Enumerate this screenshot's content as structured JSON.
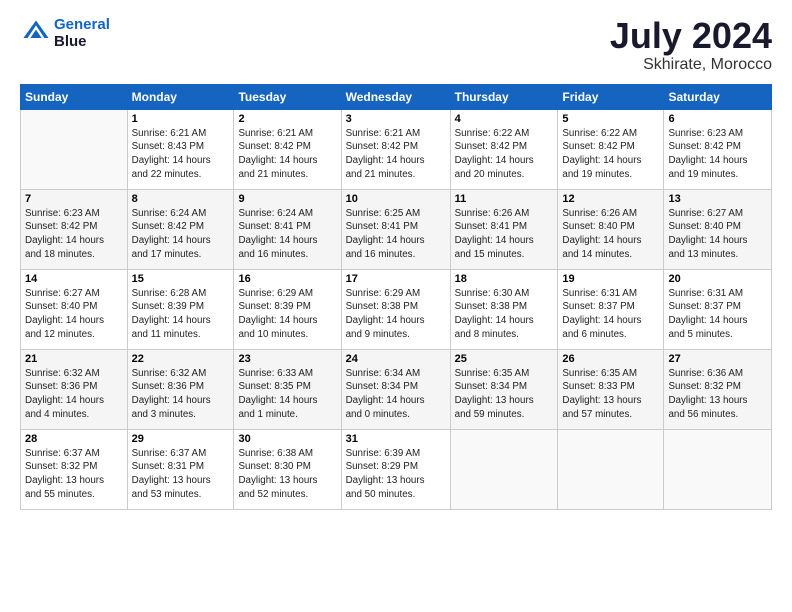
{
  "logo": {
    "line1": "General",
    "line2": "Blue"
  },
  "title": "July 2024",
  "subtitle": "Skhirate, Morocco",
  "days_of_week": [
    "Sunday",
    "Monday",
    "Tuesday",
    "Wednesday",
    "Thursday",
    "Friday",
    "Saturday"
  ],
  "weeks": [
    [
      {
        "day": "",
        "info": ""
      },
      {
        "day": "1",
        "info": "Sunrise: 6:21 AM\nSunset: 8:43 PM\nDaylight: 14 hours\nand 22 minutes."
      },
      {
        "day": "2",
        "info": "Sunrise: 6:21 AM\nSunset: 8:42 PM\nDaylight: 14 hours\nand 21 minutes."
      },
      {
        "day": "3",
        "info": "Sunrise: 6:21 AM\nSunset: 8:42 PM\nDaylight: 14 hours\nand 21 minutes."
      },
      {
        "day": "4",
        "info": "Sunrise: 6:22 AM\nSunset: 8:42 PM\nDaylight: 14 hours\nand 20 minutes."
      },
      {
        "day": "5",
        "info": "Sunrise: 6:22 AM\nSunset: 8:42 PM\nDaylight: 14 hours\nand 19 minutes."
      },
      {
        "day": "6",
        "info": "Sunrise: 6:23 AM\nSunset: 8:42 PM\nDaylight: 14 hours\nand 19 minutes."
      }
    ],
    [
      {
        "day": "7",
        "info": "Sunrise: 6:23 AM\nSunset: 8:42 PM\nDaylight: 14 hours\nand 18 minutes."
      },
      {
        "day": "8",
        "info": "Sunrise: 6:24 AM\nSunset: 8:42 PM\nDaylight: 14 hours\nand 17 minutes."
      },
      {
        "day": "9",
        "info": "Sunrise: 6:24 AM\nSunset: 8:41 PM\nDaylight: 14 hours\nand 16 minutes."
      },
      {
        "day": "10",
        "info": "Sunrise: 6:25 AM\nSunset: 8:41 PM\nDaylight: 14 hours\nand 16 minutes."
      },
      {
        "day": "11",
        "info": "Sunrise: 6:26 AM\nSunset: 8:41 PM\nDaylight: 14 hours\nand 15 minutes."
      },
      {
        "day": "12",
        "info": "Sunrise: 6:26 AM\nSunset: 8:40 PM\nDaylight: 14 hours\nand 14 minutes."
      },
      {
        "day": "13",
        "info": "Sunrise: 6:27 AM\nSunset: 8:40 PM\nDaylight: 14 hours\nand 13 minutes."
      }
    ],
    [
      {
        "day": "14",
        "info": "Sunrise: 6:27 AM\nSunset: 8:40 PM\nDaylight: 14 hours\nand 12 minutes."
      },
      {
        "day": "15",
        "info": "Sunrise: 6:28 AM\nSunset: 8:39 PM\nDaylight: 14 hours\nand 11 minutes."
      },
      {
        "day": "16",
        "info": "Sunrise: 6:29 AM\nSunset: 8:39 PM\nDaylight: 14 hours\nand 10 minutes."
      },
      {
        "day": "17",
        "info": "Sunrise: 6:29 AM\nSunset: 8:38 PM\nDaylight: 14 hours\nand 9 minutes."
      },
      {
        "day": "18",
        "info": "Sunrise: 6:30 AM\nSunset: 8:38 PM\nDaylight: 14 hours\nand 8 minutes."
      },
      {
        "day": "19",
        "info": "Sunrise: 6:31 AM\nSunset: 8:37 PM\nDaylight: 14 hours\nand 6 minutes."
      },
      {
        "day": "20",
        "info": "Sunrise: 6:31 AM\nSunset: 8:37 PM\nDaylight: 14 hours\nand 5 minutes."
      }
    ],
    [
      {
        "day": "21",
        "info": "Sunrise: 6:32 AM\nSunset: 8:36 PM\nDaylight: 14 hours\nand 4 minutes."
      },
      {
        "day": "22",
        "info": "Sunrise: 6:32 AM\nSunset: 8:36 PM\nDaylight: 14 hours\nand 3 minutes."
      },
      {
        "day": "23",
        "info": "Sunrise: 6:33 AM\nSunset: 8:35 PM\nDaylight: 14 hours\nand 1 minute."
      },
      {
        "day": "24",
        "info": "Sunrise: 6:34 AM\nSunset: 8:34 PM\nDaylight: 14 hours\nand 0 minutes."
      },
      {
        "day": "25",
        "info": "Sunrise: 6:35 AM\nSunset: 8:34 PM\nDaylight: 13 hours\nand 59 minutes."
      },
      {
        "day": "26",
        "info": "Sunrise: 6:35 AM\nSunset: 8:33 PM\nDaylight: 13 hours\nand 57 minutes."
      },
      {
        "day": "27",
        "info": "Sunrise: 6:36 AM\nSunset: 8:32 PM\nDaylight: 13 hours\nand 56 minutes."
      }
    ],
    [
      {
        "day": "28",
        "info": "Sunrise: 6:37 AM\nSunset: 8:32 PM\nDaylight: 13 hours\nand 55 minutes."
      },
      {
        "day": "29",
        "info": "Sunrise: 6:37 AM\nSunset: 8:31 PM\nDaylight: 13 hours\nand 53 minutes."
      },
      {
        "day": "30",
        "info": "Sunrise: 6:38 AM\nSunset: 8:30 PM\nDaylight: 13 hours\nand 52 minutes."
      },
      {
        "day": "31",
        "info": "Sunrise: 6:39 AM\nSunset: 8:29 PM\nDaylight: 13 hours\nand 50 minutes."
      },
      {
        "day": "",
        "info": ""
      },
      {
        "day": "",
        "info": ""
      },
      {
        "day": "",
        "info": ""
      }
    ]
  ]
}
